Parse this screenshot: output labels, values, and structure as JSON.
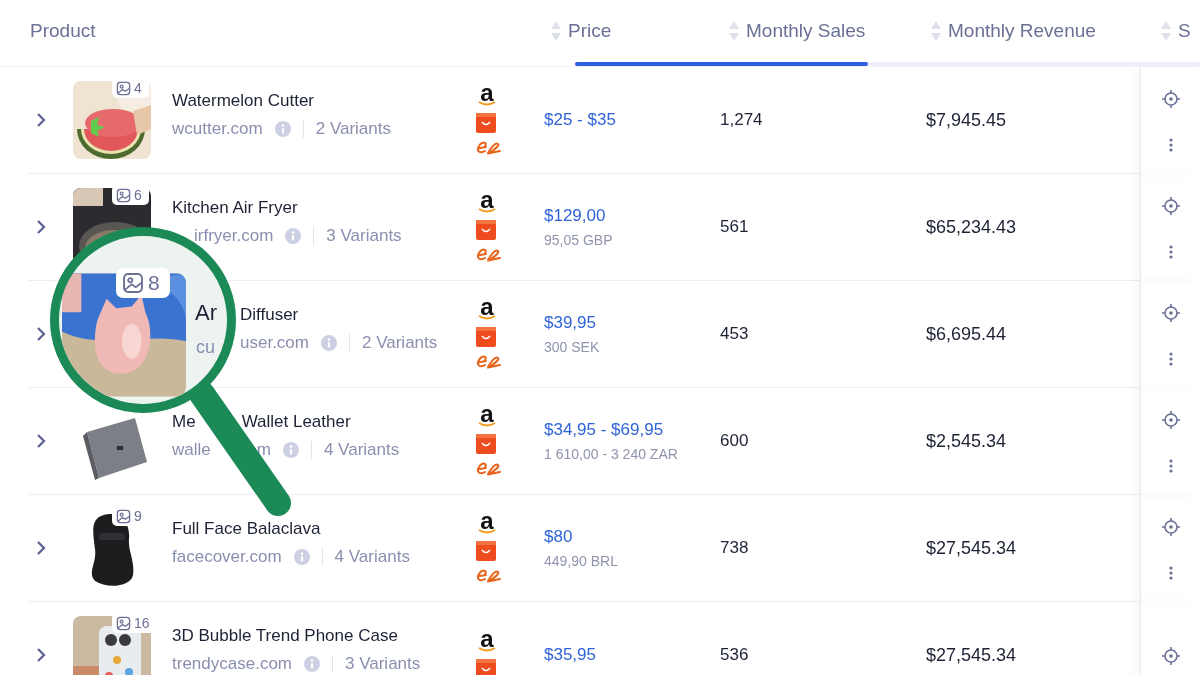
{
  "columns": [
    {
      "label": "Product",
      "sortable": false
    },
    {
      "label": "Price",
      "sortable": true
    },
    {
      "label": "Monthly Sales",
      "sortable": true
    },
    {
      "label": "Monthly Revenue",
      "sortable": true
    },
    {
      "label": "S",
      "sortable": true
    }
  ],
  "rows": [
    {
      "thumbnail": {
        "kind": "picture"
      },
      "images": "4",
      "name": [
        "Watermelon Cutter"
      ],
      "domain": [
        "wcutter.com"
      ],
      "variants": "2 Variants",
      "marketplaces": [
        {
          "kind": "letter",
          "text": "a"
        },
        {
          "kind": "bag"
        },
        {
          "kind": "swoosh"
        }
      ],
      "price": "$25 - $35",
      "sales": "1,274",
      "revenue": "$7,945.45"
    },
    {
      "thumbnail": {
        "kind": "picture"
      },
      "images": "6",
      "domain_covered": true,
      "name": [
        "Kitchen Air Fryer"
      ],
      "domain": [
        "irfryer.com"
      ],
      "variants": "3 Variants",
      "marketplaces": [
        {
          "kind": "letter",
          "text": "a"
        },
        {
          "kind": "bag"
        },
        {
          "kind": "swoosh"
        }
      ],
      "price": "$129,00",
      "price_local": "95,05 GBP",
      "sales": "561",
      "revenue": "$65,234.43"
    },
    {
      "name_covered": true,
      "domain_covered": true,
      "name": [
        "Diffuser"
      ],
      "domain": [
        "user.com"
      ],
      "variants": "2 Variants",
      "marketplaces": [
        {
          "kind": "letter",
          "text": "a"
        },
        {
          "kind": "bag"
        },
        {
          "kind": "swoosh"
        }
      ],
      "price": "$39,95",
      "price_local": "300 SEK",
      "sales": "453",
      "revenue": "$6,695.44"
    },
    {
      "thumbnail": {
        "kind": "picture"
      },
      "name": [
        "Me",
        "Wallet Leather"
      ],
      "domain": [
        "walle",
        "m"
      ],
      "variants": "4 Variants",
      "marketplaces": [
        {
          "kind": "letter",
          "text": "a"
        },
        {
          "kind": "bag"
        },
        {
          "kind": "swoosh"
        }
      ],
      "price": "$34,95 - $69,95",
      "price_local": "1 610,00 - 3 240 ZAR",
      "sales": "600",
      "revenue": "$2,545.34"
    },
    {
      "thumbnail": {
        "kind": "picture"
      },
      "images": "9",
      "name": [
        "Full Face Balaclava"
      ],
      "domain": [
        "facecover.com"
      ],
      "variants": "4 Variants",
      "marketplaces": [
        {
          "kind": "letter",
          "text": "a"
        },
        {
          "kind": "bag"
        },
        {
          "kind": "swoosh"
        }
      ],
      "price": "$80",
      "price_local": "449,90 BRL",
      "sales": "738",
      "revenue": "$27,545.34"
    },
    {
      "thumbnail": {
        "kind": "picture"
      },
      "images": "16",
      "name": [
        "3D Bubble Trend Phone Case"
      ],
      "domain": [
        "trendycase.com"
      ],
      "variants": "3 Variants",
      "marketplaces": [
        {
          "kind": "letter",
          "text": "a"
        },
        {
          "kind": "bag"
        }
      ],
      "price": "$35,95",
      "sales": "536",
      "revenue": "$27,545.34"
    }
  ],
  "magnifier": {
    "kind": "picture",
    "images": "8",
    "title": "Ar",
    "domain": "cu"
  }
}
